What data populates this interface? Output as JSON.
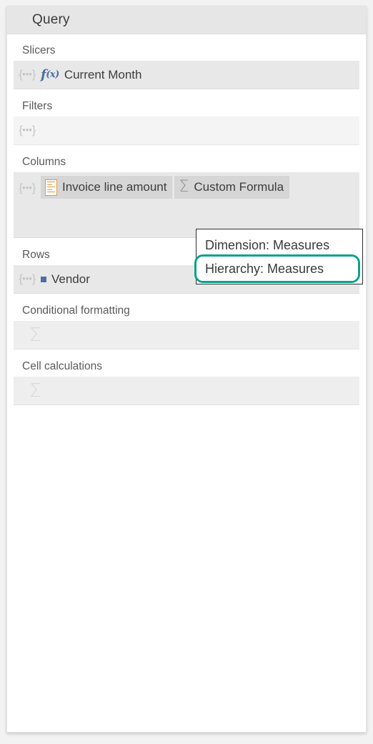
{
  "panel": {
    "title": "Query"
  },
  "sections": [
    {
      "label": "Slicers",
      "filled": true,
      "handle": "{...}",
      "items": [
        {
          "icon": "fx-icon",
          "label": "Current Month",
          "style": "plain"
        }
      ]
    },
    {
      "label": "Filters",
      "filled": false,
      "handle": "{...}",
      "items": []
    },
    {
      "label": "Columns",
      "filled": true,
      "tall": true,
      "handle": "{...}",
      "items": [
        {
          "icon": "ruler-icon",
          "label": "Invoice line amount",
          "style": "pill"
        },
        {
          "icon": "sigma-icon",
          "label": "Custom Formula",
          "style": "pill"
        }
      ]
    },
    {
      "label": "Rows",
      "filled": true,
      "handle": "{...}",
      "items": [
        {
          "icon": "square-icon",
          "label": "Vendor",
          "style": "plain"
        }
      ]
    },
    {
      "label": "Conditional formatting",
      "filled": false,
      "sigma_placeholder": "Σ",
      "items": []
    },
    {
      "label": "Cell calculations",
      "filled": false,
      "sigma_placeholder": "Σ",
      "items": []
    }
  ],
  "tooltip": {
    "line1": "Dimension: Measures",
    "line2": "Hierarchy: Measures",
    "highlight_color": "#0ba18c"
  },
  "icons": {
    "fx": "f(x)",
    "sigma": "Σ"
  }
}
